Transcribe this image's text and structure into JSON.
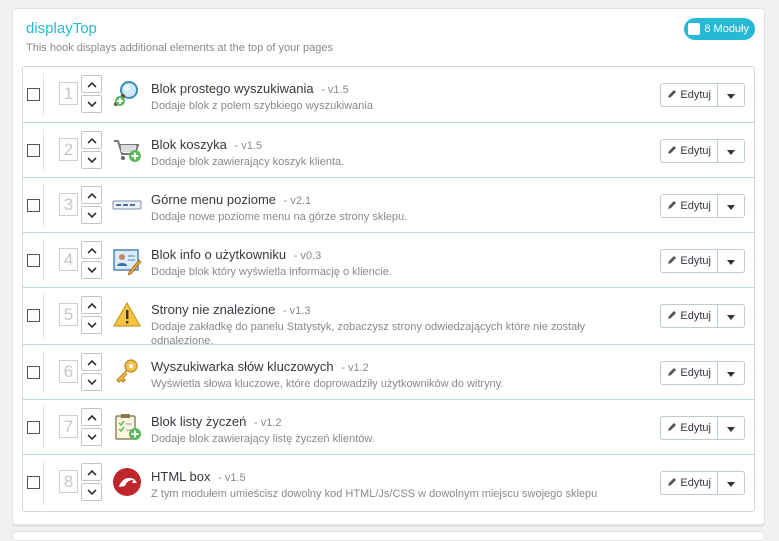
{
  "hook": {
    "title": "displayTop",
    "description": "This hook displays additional elements at the top of your pages",
    "badge": "8 Moduły"
  },
  "colors": {
    "accent": "#25b9d7",
    "text": "#363a41",
    "muted": "#8a8a8a"
  },
  "edit_label": "Edytuj",
  "modules": [
    {
      "position": "1",
      "name": "Blok prostego wyszukiwania",
      "version": "- v1.5",
      "description": "Dodaje blok z polem szybkiego wyszukiwania",
      "icon": "search-module-icon"
    },
    {
      "position": "2",
      "name": "Blok koszyka",
      "version": "- v1.5",
      "description": "Dodaje blok zawierający koszyk klienta.",
      "icon": "cart-module-icon"
    },
    {
      "position": "3",
      "name": "Górne menu poziome",
      "version": "- v2.1",
      "description": "Dodaje nowe poziome menu na górze strony sklepu.",
      "icon": "menu-module-icon"
    },
    {
      "position": "4",
      "name": "Blok info o użytkowniku",
      "version": "- v0.3",
      "description": "Dodaje blok który wyświetla informację o kliencie.",
      "icon": "user-info-module-icon"
    },
    {
      "position": "5",
      "name": "Strony nie znalezione",
      "version": "- v1.3",
      "description": "Dodaje zakładkę do panelu Statystyk, zobaczysz strony odwiedzających które nie zostały odnalezione.",
      "icon": "warning-module-icon"
    },
    {
      "position": "6",
      "name": "Wyszukiwarka słów kluczowych",
      "version": "- v1.2",
      "description": "Wyświetla słowa kluczowe, które doprowadziły użytkowników do witryny.",
      "icon": "keys-module-icon"
    },
    {
      "position": "7",
      "name": "Blok listy życzeń",
      "version": "- v1.2",
      "description": "Dodaje blok zawierający listę życzeń klientów.",
      "icon": "wishlist-module-icon"
    },
    {
      "position": "8",
      "name": "HTML box",
      "version": "- v1.5",
      "description": "Z tym modułem umieścisz dowolny kod HTML/Js/CSS w dowolnym miejscu swojego sklepu",
      "icon": "html-box-module-icon"
    }
  ]
}
